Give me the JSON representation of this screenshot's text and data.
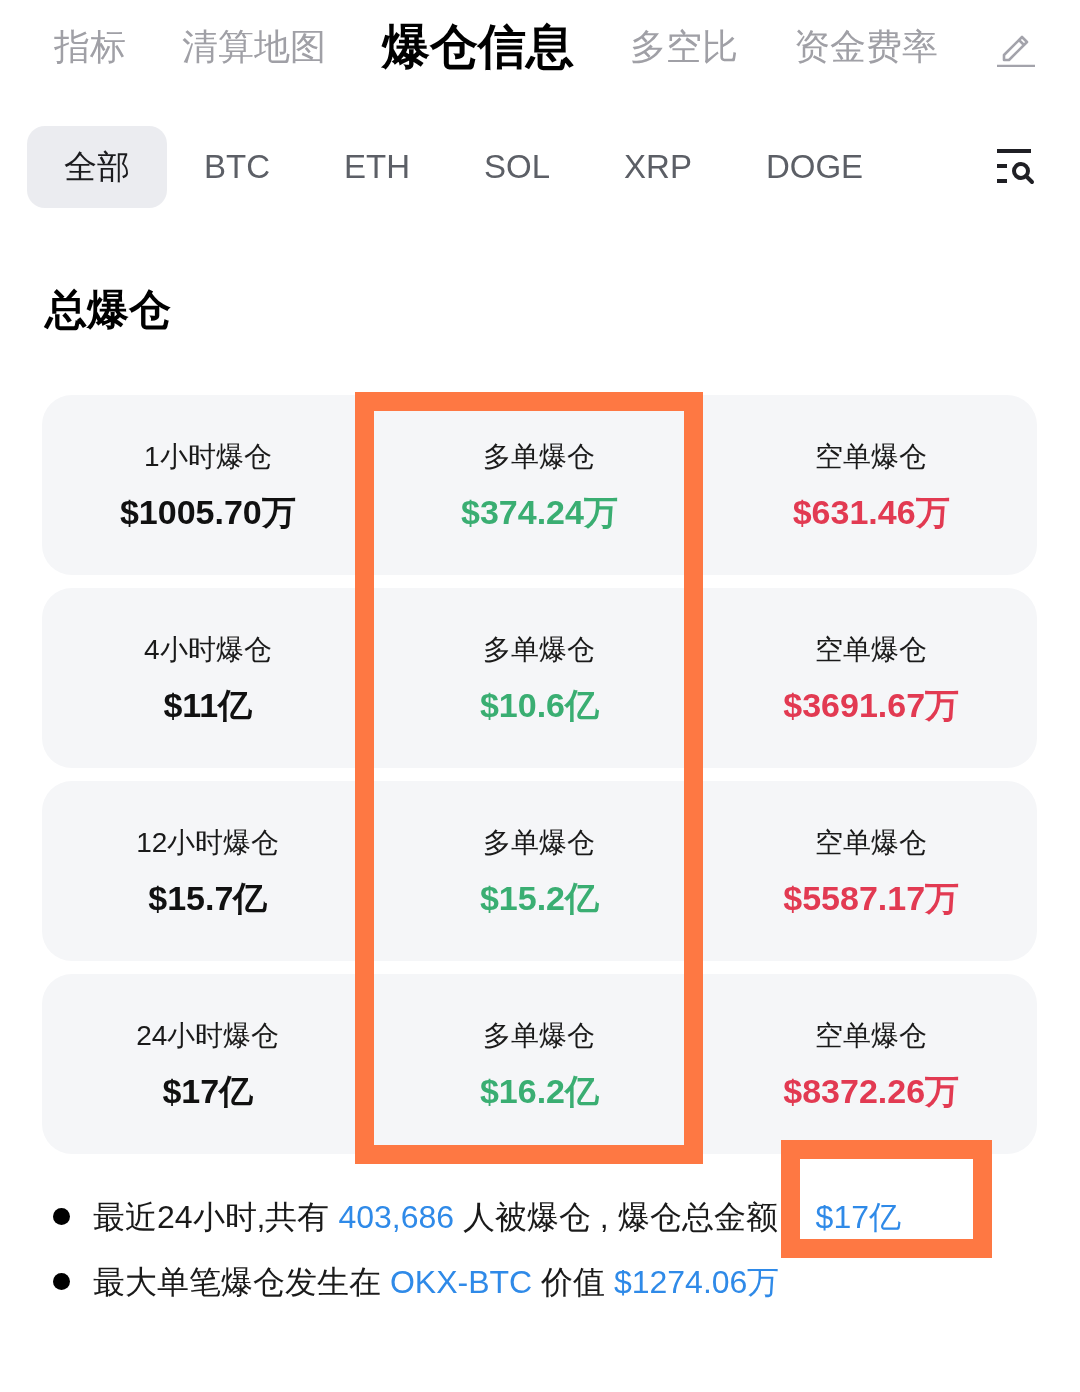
{
  "top_tabs": [
    {
      "label": "指标",
      "selected": false
    },
    {
      "label": "清算地图",
      "selected": false
    },
    {
      "label": "爆仓信息",
      "selected": true
    },
    {
      "label": "多空比",
      "selected": false
    },
    {
      "label": "资金费率",
      "selected": false
    }
  ],
  "coin_filters": [
    {
      "label": "全部",
      "selected": true
    },
    {
      "label": "BTC",
      "selected": false
    },
    {
      "label": "ETH",
      "selected": false
    },
    {
      "label": "SOL",
      "selected": false
    },
    {
      "label": "XRP",
      "selected": false
    },
    {
      "label": "DOGE",
      "selected": false
    }
  ],
  "section_title": "总爆仓",
  "stat_columns": [
    {
      "framed": false
    },
    {
      "framed": true
    },
    {
      "framed": false
    }
  ],
  "stat_rows": [
    {
      "cells": [
        {
          "kind": "total",
          "label": "1小时爆仓",
          "value": "$1005.70万"
        },
        {
          "kind": "long",
          "label": "多单爆仓",
          "value": "$374.24万"
        },
        {
          "kind": "short",
          "label": "空单爆仓",
          "value": "$631.46万"
        }
      ]
    },
    {
      "cells": [
        {
          "kind": "total",
          "label": "4小时爆仓",
          "value": "$11亿"
        },
        {
          "kind": "long",
          "label": "多单爆仓",
          "value": "$10.6亿"
        },
        {
          "kind": "short",
          "label": "空单爆仓",
          "value": "$3691.67万"
        }
      ]
    },
    {
      "cells": [
        {
          "kind": "total",
          "label": "12小时爆仓",
          "value": "$15.7亿"
        },
        {
          "kind": "long",
          "label": "多单爆仓",
          "value": "$15.2亿"
        },
        {
          "kind": "short",
          "label": "空单爆仓",
          "value": "$5587.17万"
        }
      ]
    },
    {
      "cells": [
        {
          "kind": "total",
          "label": "24小时爆仓",
          "value": "$17亿"
        },
        {
          "kind": "long",
          "label": "多单爆仓",
          "value": "$16.2亿"
        },
        {
          "kind": "short",
          "label": "空单爆仓",
          "value": "$8372.26万"
        }
      ]
    }
  ],
  "notes": [
    {
      "parts": [
        {
          "text": "最近24小时,共有 ",
          "highlight": false,
          "framed": false
        },
        {
          "text": "403,686",
          "highlight": true,
          "framed": false
        },
        {
          "text": " 人被爆仓 , 爆仓总金额",
          "highlight": false,
          "framed": false
        },
        {
          "text": "$17亿",
          "highlight": true,
          "framed": true
        }
      ]
    },
    {
      "parts": [
        {
          "text": "最大单笔爆仓发生在 ",
          "highlight": false,
          "framed": false
        },
        {
          "text": "OKX-BTC",
          "highlight": true,
          "framed": false
        },
        {
          "text": " 价值 ",
          "highlight": false,
          "framed": false
        },
        {
          "text": "$1274.06万",
          "highlight": true,
          "framed": false
        }
      ]
    }
  ]
}
